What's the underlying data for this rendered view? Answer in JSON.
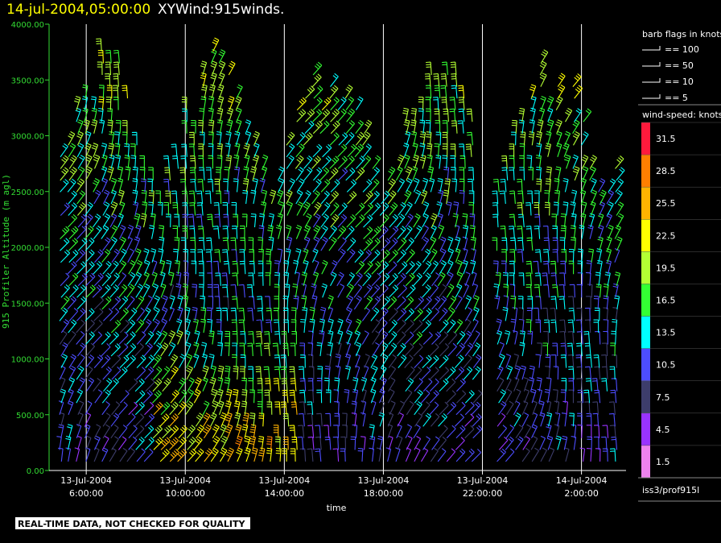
{
  "title": {
    "datetime": "14-jul-2004,05:00:00",
    "product": "XYWind:915winds."
  },
  "notice": "REAL-TIME DATA, NOT CHECKED FOR QUALITY",
  "station_id": "iss3/prof915l",
  "chart_data": {
    "type": "wind-barb time-height",
    "xlabel": "time",
    "ylabel": "915 Profiler Altitude (m agl)",
    "ylim": [
      0,
      4000
    ],
    "y_ticks": [
      "0.00",
      "500.00",
      "1000.00",
      "1500.00",
      "2000.00",
      "2500.00",
      "3000.00",
      "3500.00",
      "4000.00"
    ],
    "y_tick_values": [
      0,
      500,
      1000,
      1500,
      2000,
      2500,
      3000,
      3500,
      4000
    ],
    "x_range_hours": [
      4.5,
      27.8
    ],
    "x_ticks": [
      {
        "date": "13-Jul-2004",
        "time": "6:00:00",
        "hour": 6
      },
      {
        "date": "13-Jul-2004",
        "time": "10:00:00",
        "hour": 10
      },
      {
        "date": "13-Jul-2004",
        "time": "14:00:00",
        "hour": 14
      },
      {
        "date": "13-Jul-2004",
        "time": "18:00:00",
        "hour": 18
      },
      {
        "date": "13-Jul-2004",
        "time": "22:00:00",
        "hour": 22
      },
      {
        "date": "14-Jul-2004",
        "time": "2:00:00",
        "hour": 26
      }
    ],
    "grid": "vertical lines at major ticks",
    "legend_barb": {
      "title": "barb flags in knots",
      "items": [
        "== 100",
        "== 50",
        "== 10",
        "== 5"
      ]
    },
    "legend_speed": {
      "title": "wind-speed: knots",
      "bins": [
        {
          "label": "31.5",
          "color": "#ff1a3c"
        },
        {
          "label": "28.5",
          "color": "#ff7f00"
        },
        {
          "label": "25.5",
          "color": "#ffb300"
        },
        {
          "label": "22.5",
          "color": "#ffff00"
        },
        {
          "label": "19.5",
          "color": "#b3ff33"
        },
        {
          "label": "16.5",
          "color": "#33ff33"
        },
        {
          "label": "13.5",
          "color": "#00ffff"
        },
        {
          "label": "10.5",
          "color": "#4d4dff"
        },
        {
          "label": "7.5",
          "color": "#3d3d6b"
        },
        {
          "label": "4.5",
          "color": "#9933ff"
        },
        {
          "label": "1.5",
          "color": "#ee82ee"
        }
      ]
    },
    "data_gap_hours": [
      [
        21.7,
        22.3
      ]
    ]
  },
  "colors": {
    "background": "#000000",
    "axis_y": "#33dd33",
    "axis_x": "#ffffff",
    "title_date": "#ffff00",
    "title_text": "#ffffff"
  }
}
